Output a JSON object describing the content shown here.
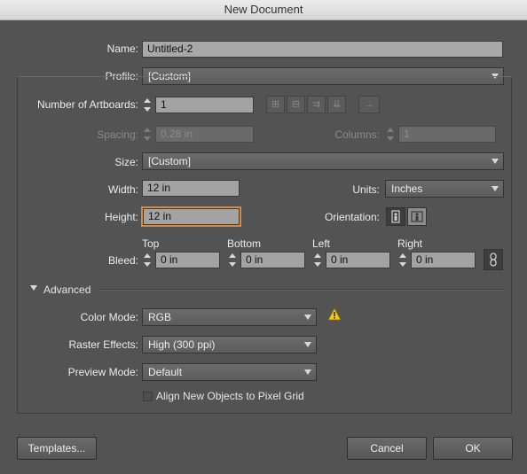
{
  "window": {
    "title": "New Document"
  },
  "name": {
    "label": "Name:",
    "value": "Untitled-2"
  },
  "profile": {
    "label": "Profile:",
    "value": "[Custom]"
  },
  "artboards": {
    "label": "Number of Artboards:",
    "value": "1"
  },
  "spacing": {
    "label": "Spacing:",
    "value": "0.28 in"
  },
  "columns": {
    "label": "Columns:",
    "value": "1"
  },
  "size": {
    "label": "Size:",
    "value": "[Custom]"
  },
  "width": {
    "label": "Width:",
    "value": "12 in"
  },
  "units": {
    "label": "Units:",
    "value": "Inches"
  },
  "height": {
    "label": "Height:",
    "value": "12 in"
  },
  "orientation": {
    "label": "Orientation:"
  },
  "bleed": {
    "label": "Bleed:",
    "top": {
      "label": "Top",
      "value": "0 in"
    },
    "bottom": {
      "label": "Bottom",
      "value": "0 in"
    },
    "left": {
      "label": "Left",
      "value": "0 in"
    },
    "right": {
      "label": "Right",
      "value": "0 in"
    }
  },
  "advanced": {
    "label": "Advanced",
    "color_mode": {
      "label": "Color Mode:",
      "value": "RGB"
    },
    "raster_effects": {
      "label": "Raster Effects:",
      "value": "High (300 ppi)"
    },
    "preview_mode": {
      "label": "Preview Mode:",
      "value": "Default"
    },
    "align_pixel_grid": {
      "label": "Align New Objects to Pixel Grid",
      "checked": false
    }
  },
  "buttons": {
    "templates": "Templates...",
    "cancel": "Cancel",
    "ok": "OK"
  },
  "colors": {
    "accent_focus": "#d9893b",
    "warning": "#f2c811",
    "background": "#535353"
  }
}
